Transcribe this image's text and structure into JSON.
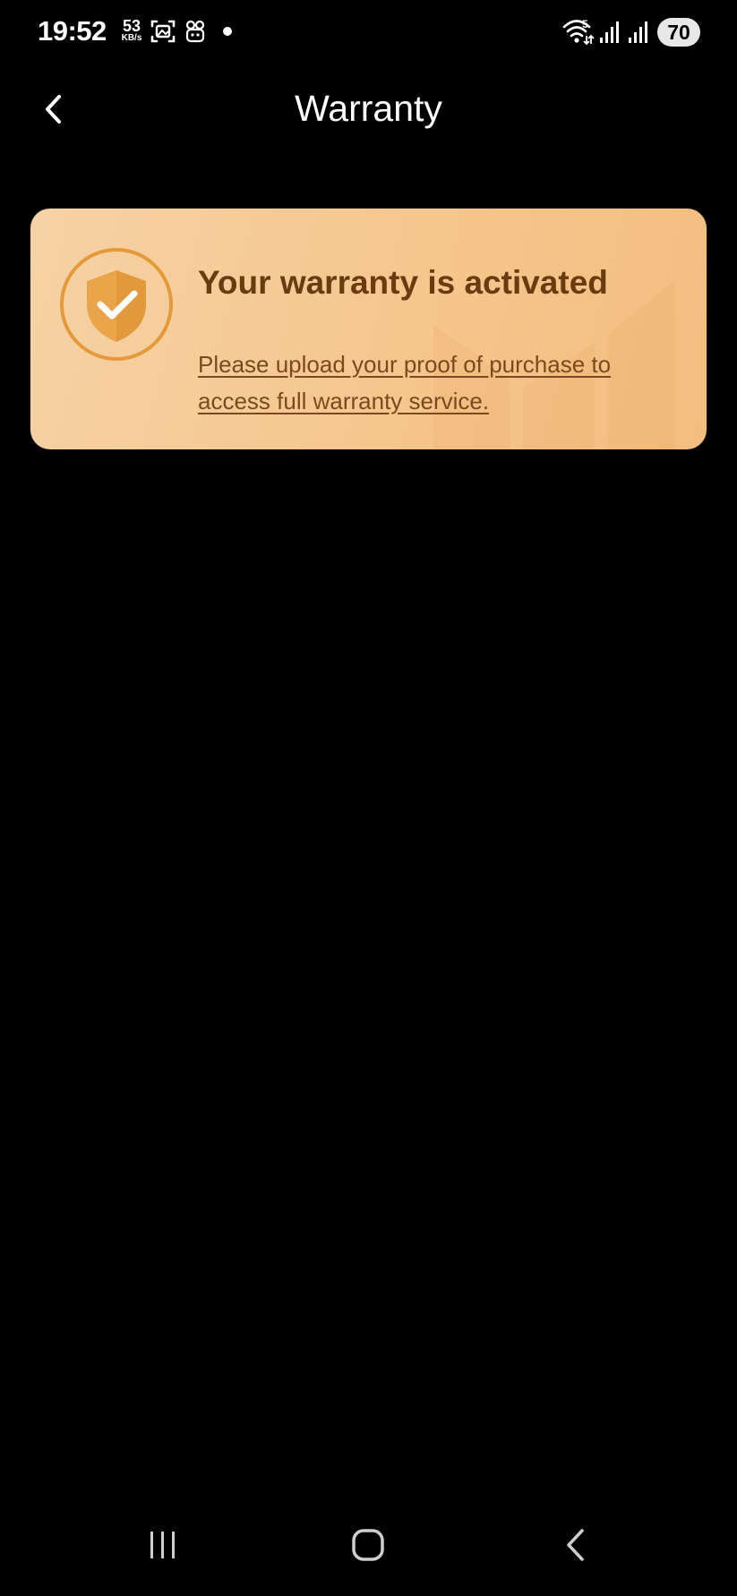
{
  "status_bar": {
    "time": "19:52",
    "speed_value": "53",
    "speed_unit": "KB/s",
    "wifi_badge": "5",
    "battery": "70"
  },
  "app_bar": {
    "title": "Warranty"
  },
  "warranty_card": {
    "heading": "Your warranty is activated",
    "link_text": "Please upload your proof of purchase to access full warranty service.",
    "colors": {
      "card_gradient_start": "#f5d2a6",
      "card_gradient_end": "#f3bd7f",
      "heading": "#6a3b0e",
      "link": "#7a4a1e",
      "badge_ring": "#e59a3a"
    }
  },
  "icons": {
    "back": "chevron-left-icon",
    "badge": "shield-check-icon",
    "nav_recents": "recents-icon",
    "nav_home": "home-icon",
    "nav_back": "back-icon"
  },
  "colors": {
    "background": "#000000",
    "text_primary": "#ffffff"
  }
}
